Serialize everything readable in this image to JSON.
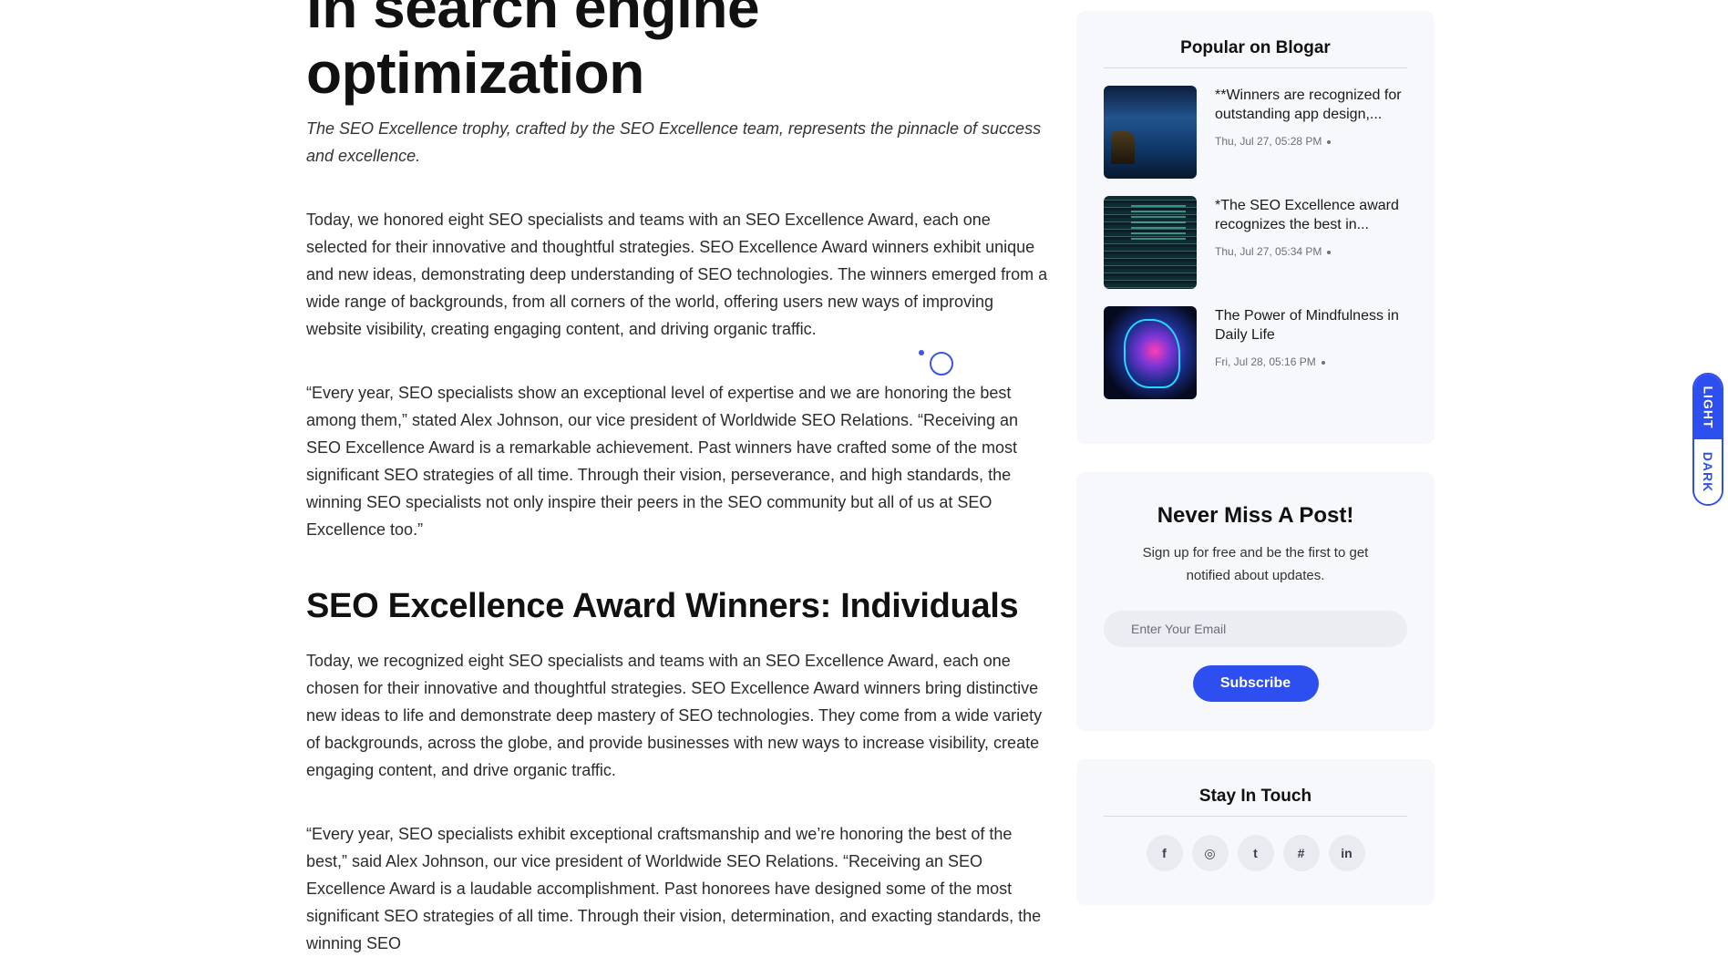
{
  "article": {
    "title_line1": "in search engine",
    "title_line2": "optimization",
    "lead": "The SEO Excellence trophy, crafted by the SEO Excellence team, represents the pinnacle of success and excellence.",
    "paragraphs": [
      "Today, we honored eight SEO specialists and teams with an SEO Excellence Award, each one selected for their innovative and thoughtful strategies. SEO Excellence Award winners exhibit unique and new ideas, demonstrating deep understanding of SEO technologies. The winners emerged from a wide range of backgrounds, from all corners of the world, offering users new ways of improving website visibility, creating engaging content, and driving organic traffic.",
      "“Every year, SEO specialists show an exceptional level of expertise and we are honoring the best among them,” stated Alex Johnson, our vice president of Worldwide SEO Relations. “Receiving an SEO Excellence Award is a remarkable achievement. Past winners have crafted some of the most significant SEO strategies of all time. Through their vision, perseverance, and high standards, the winning SEO specialists not only inspire their peers in the SEO community but all of us at SEO Excellence too.”"
    ],
    "section_heading": "SEO Excellence Award Winners: Individuals",
    "section_paragraphs": [
      "Today, we recognized eight SEO specialists and teams with an SEO Excellence Award, each one chosen for their innovative and thoughtful strategies. SEO Excellence Award winners bring distinctive new ideas to life and demonstrate deep mastery of SEO technologies. They come from a wide variety of backgrounds, across the globe, and provide businesses with new ways to increase visibility, create engaging content, and drive organic traffic.",
      "“Every year, SEO specialists exhibit exceptional craftsmanship and we’re honoring the best of the best,” said Alex Johnson, our vice president of Worldwide SEO Relations. “Receiving an SEO Excellence Award is a laudable accomplishment. Past honorees have designed some of the most significant SEO strategies of all time. Through their vision, determination, and exacting standards, the winning SEO"
    ]
  },
  "sidebar": {
    "popular": {
      "heading": "Popular on Blogar",
      "posts": [
        {
          "title": "**Winners are recognized for outstanding app design,...",
          "date": "Thu, Jul 27, 05:28 PM"
        },
        {
          "title": "*The SEO Excellence award recognizes the best in...",
          "date": "Thu, Jul 27, 05:34 PM"
        },
        {
          "title": "The Power of Mindfulness in Daily Life",
          "date": "Fri, Jul 28, 05:16 PM"
        }
      ]
    },
    "newsletter": {
      "heading": "Never Miss A Post!",
      "subtext": "Sign up for free and be the first to get notified about updates.",
      "email_placeholder": "Enter Your Email",
      "subscribe_label": "Subscribe"
    },
    "touch": {
      "heading": "Stay In Touch",
      "socials": [
        {
          "icon": "facebook-icon",
          "glyph": "f"
        },
        {
          "icon": "instagram-icon",
          "glyph": "◎"
        },
        {
          "icon": "twitter-icon",
          "glyph": "t"
        },
        {
          "icon": "slack-icon",
          "glyph": "#"
        },
        {
          "icon": "linkedin-icon",
          "glyph": "in"
        }
      ]
    }
  },
  "theme_toggle": {
    "light": "LIGHT",
    "dark": "DARK",
    "active": "light"
  },
  "colors": {
    "accent": "#2e4ff0",
    "card_bg": "#f7f8fb"
  }
}
